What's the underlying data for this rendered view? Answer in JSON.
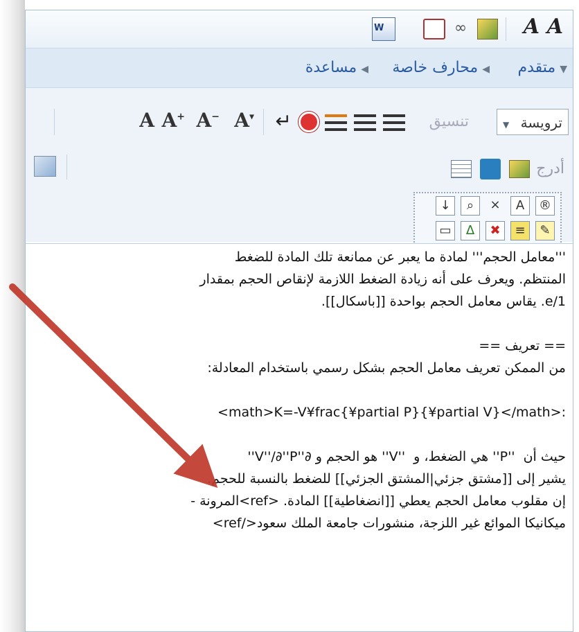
{
  "toolbar": {
    "font_size_large": "A",
    "font_size_small": "A",
    "menu": {
      "advanced": "متقدم",
      "special_chars": "محارف خاصة",
      "help": "مساعدة"
    },
    "heading_dropdown": "ترويسة",
    "format_label": "تنسيق",
    "insert_label": "أدرج",
    "format_buttons": [
      "A",
      "A",
      "A",
      "A"
    ],
    "format_superscripts": [
      "",
      "+",
      "−",
      "▾"
    ]
  },
  "content": {
    "lines": [
      "'''معامل الحجم''' لمادة ما يعبر عن ممانعة تلك المادة للضغط",
      "المنتظم. ويعرف على أنه زيادة الضغط اللازمة لإنقاص الحجم بمقدار",
      "e/1. يقاس معامل الحجم بواحدة [[باسكال]].",
      "",
      "== تعريف ==",
      "من الممكن تعريف معامل الحجم بشكل رسمي باستخدام المعادلة:",
      "",
      ":<math>K=-V¥frac{¥partial P}{¥partial V}</math>",
      "",
      "حيث أن  ''P'' هي الضغط، و  ''V'' هو الحجم و ∂''V''/∂''P''",
      "يشير إلى [[مشتق جزئي|المشتق الجزئي]] للضغط بالنسبة للحجم.",
      "إن مقلوب معامل الحجم يعطي [[انضغاطية]] المادة. <ref>المرونة -",
      "ميكانيكا الموائع غير اللزجة، منشورات جامعة الملك سعود</ref>"
    ]
  },
  "colors": {
    "toolbar_bg": "#e8f1f8",
    "link": "#2a5aa0",
    "arrow": "#c0392b"
  }
}
